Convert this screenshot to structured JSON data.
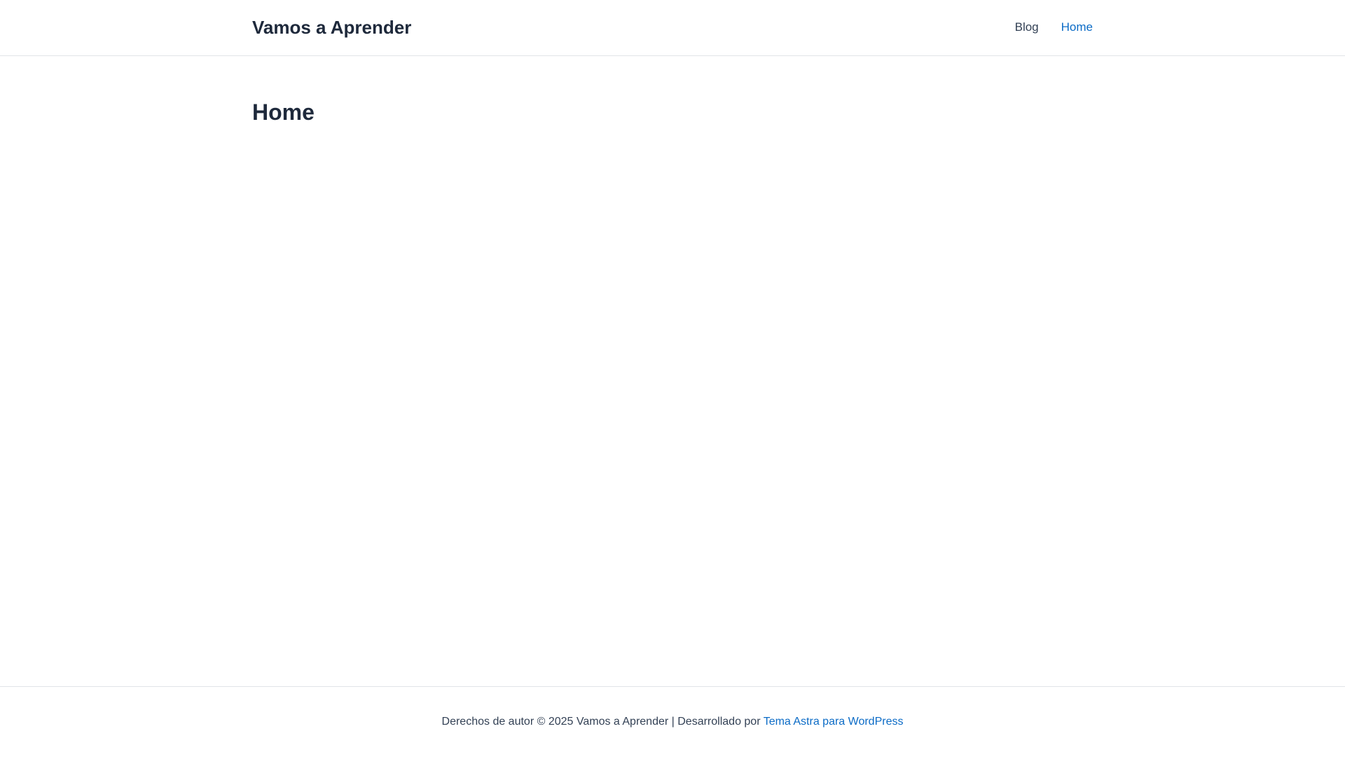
{
  "header": {
    "site_title": "Vamos a Aprender",
    "nav": [
      {
        "label": "Blog"
      },
      {
        "label": "Home"
      }
    ]
  },
  "main": {
    "page_title": "Home"
  },
  "footer": {
    "copyright_text": "Derechos de autor © 2025 Vamos a Aprender | Desarrollado por",
    "theme_link_label": "Tema Astra para WordPress"
  },
  "colors": {
    "link": "#0b6bc6",
    "heading": "#1e293b",
    "text": "#334155",
    "border": "#e1e4e8",
    "background": "#ffffff"
  }
}
